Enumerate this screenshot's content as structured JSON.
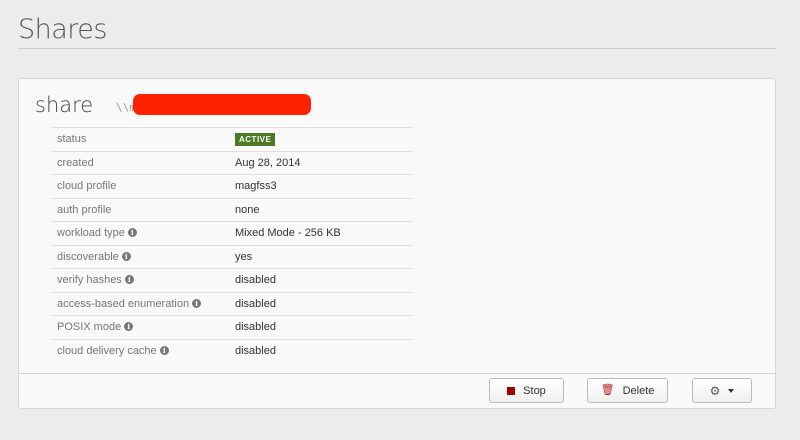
{
  "page": {
    "title": "Shares"
  },
  "share": {
    "name": "share",
    "path_prefix": "\\\\m",
    "properties": [
      {
        "key": "status",
        "value": "ACTIVE",
        "info": false,
        "badge": true
      },
      {
        "key": "created",
        "value": "Aug 28, 2014",
        "info": false
      },
      {
        "key": "cloud profile",
        "value": "magfss3",
        "info": false
      },
      {
        "key": "auth profile",
        "value": "none",
        "info": false
      },
      {
        "key": "workload type",
        "value": "Mixed Mode - 256 KB",
        "info": true
      },
      {
        "key": "discoverable",
        "value": "yes",
        "info": true
      },
      {
        "key": "verify hashes",
        "value": "disabled",
        "info": true
      },
      {
        "key": "access-based enumeration",
        "value": "disabled",
        "info": true
      },
      {
        "key": "POSIX mode",
        "value": "disabled",
        "info": true
      },
      {
        "key": "cloud delivery cache",
        "value": "disabled",
        "info": true
      }
    ]
  },
  "actions": {
    "stop_label": "Stop",
    "delete_label": "Delete"
  },
  "colors": {
    "active_badge": "#4a7a22",
    "stop_icon": "#a30000",
    "redaction": "#ff2200"
  },
  "icons": {
    "info": "info-icon",
    "stop": "stop-icon",
    "delete": "trash-icon",
    "settings": "gear-icon",
    "dropdown": "caret-down-icon"
  }
}
